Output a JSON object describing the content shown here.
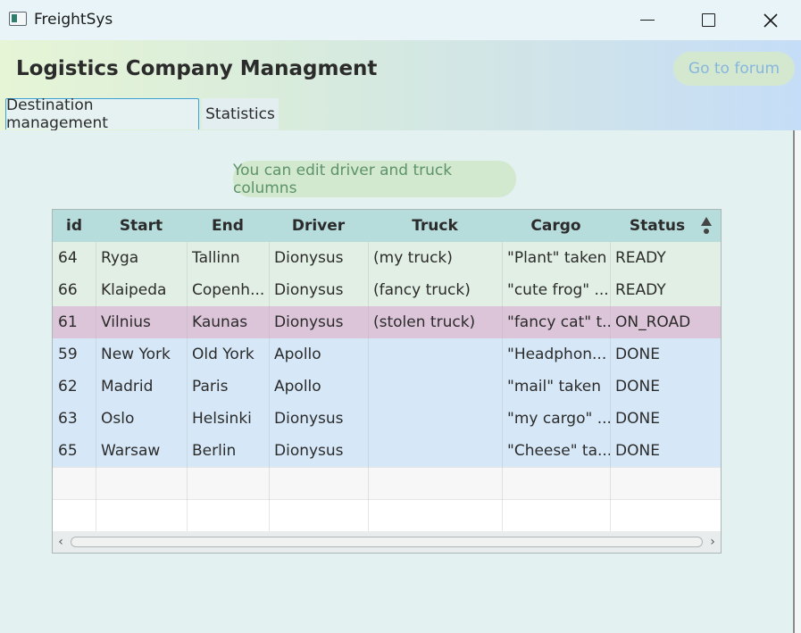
{
  "window": {
    "title": "FreightSys"
  },
  "header": {
    "title": "Logistics Company Managment",
    "forum_button": "Go to forum"
  },
  "tabs": [
    {
      "label": "Destination management",
      "active": true
    },
    {
      "label": "Statistics",
      "active": false
    }
  ],
  "hint": "You can edit driver and truck columns",
  "table": {
    "columns": [
      "id",
      "Start",
      "End",
      "Driver",
      "Truck",
      "Cargo",
      "Status"
    ],
    "sort": {
      "column": "Status",
      "direction": "ascending"
    },
    "rows": [
      {
        "id": "64",
        "start": "Ryga",
        "end": "Tallinn",
        "driver": "Dionysus",
        "truck": "(my  truck)",
        "cargo": "\"Plant\" taken",
        "status": "READY",
        "color": "#e2efe4"
      },
      {
        "id": "66",
        "start": "Klaipeda",
        "end": "Copenh...",
        "driver": "Dionysus",
        "truck": "(fancy truck)",
        "cargo": "\"cute frog\" ...",
        "status": "READY",
        "color": "#e2efe4"
      },
      {
        "id": "61",
        "start": "Vilnius",
        "end": "Kaunas",
        "driver": "Dionysus",
        "truck": "(stolen truck)",
        "cargo": "\"fancy cat\" t...",
        "status": "ON_ROAD",
        "color": "#dcc5d9"
      },
      {
        "id": "59",
        "start": "New York",
        "end": "Old York",
        "driver": "Apollo",
        "truck": "",
        "cargo": "\"Headphon...",
        "status": "DONE",
        "color": "#d6e8f7"
      },
      {
        "id": "62",
        "start": "Madrid",
        "end": "Paris",
        "driver": "Apollo",
        "truck": "",
        "cargo": "\"mail\" taken",
        "status": "DONE",
        "color": "#d6e8f7"
      },
      {
        "id": "63",
        "start": "Oslo",
        "end": "Helsinki",
        "driver": "Dionysus",
        "truck": "",
        "cargo": "\"my cargo\" ...",
        "status": "DONE",
        "color": "#d6e8f7"
      },
      {
        "id": "65",
        "start": "Warsaw",
        "end": "Berlin",
        "driver": "Dionysus",
        "truck": "",
        "cargo": "\"Cheese\" ta...",
        "status": "DONE",
        "color": "#d6e8f7"
      }
    ],
    "empty_row_count": 2
  },
  "colors": {
    "header_row": "#b7dcdc",
    "ready": "#e2efe4",
    "on_road": "#dcc5d9",
    "done": "#d6e8f7",
    "accent": "#3aa0d6"
  }
}
